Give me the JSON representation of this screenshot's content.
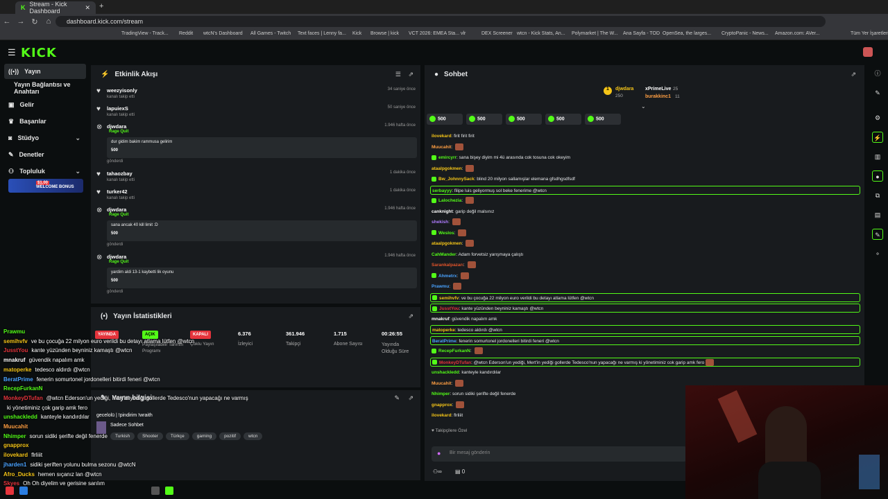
{
  "browser": {
    "tab_title": "Stream - Kick Dashboard",
    "url": "dashboard.kick.com/stream",
    "all_bookmarks": "Tüm Yer İşaretleri",
    "bookmarks": [
      "TradingView - Track...",
      "Reddit",
      "wtcN's Dashboard",
      "All Games - Twitch",
      "Text faces | Lenny fa...",
      "Kick",
      "Browse | kick",
      "VCT 2026: EMEA Sta...",
      "vlr",
      "DEX Screener",
      "wtcn - Kick Stats, An...",
      "Polymarket | The W...",
      "Ana Sayfa - TOD",
      "OpenSea, the larges...",
      "CryptoPanic - News...",
      "Amazon.com: AVer..."
    ]
  },
  "sidebar": {
    "items": [
      {
        "label": "Yayın",
        "icon": "broadcast-icon"
      },
      {
        "label": "Yayın Bağlantısı ve Anahtarı"
      },
      {
        "label": "Gelir",
        "icon": "wallet-icon"
      },
      {
        "label": "Başarılar",
        "icon": "trophy-icon"
      },
      {
        "label": "Stüdyo",
        "icon": "camera-icon"
      },
      {
        "label": "Denetler",
        "icon": "wrench-icon"
      },
      {
        "label": "Topluluk",
        "icon": "users-icon"
      }
    ],
    "promo": {
      "amount": "$1.00",
      "text": "WELCOME BONUS"
    }
  },
  "activity": {
    "title": "Etkinlik Akışı",
    "items": [
      {
        "user": "weezyisonly",
        "sub": "kanalı takip etti",
        "time": "34 saniye önce",
        "type": "follow"
      },
      {
        "user": "lapuiexS",
        "sub": "kanalı takip etti",
        "time": "50 saniye önce",
        "type": "follow"
      },
      {
        "user": "djwdara",
        "action": "Rage Quit",
        "time": "1.946 hafta önce",
        "type": "kicks",
        "message": "dur gidim bakim rammusa gelirim",
        "amount": "500",
        "sent": "gönderdi"
      },
      {
        "user": "tahaozbay",
        "sub": "kanalı takip etti",
        "time": "1 dakika önce",
        "type": "follow"
      },
      {
        "user": "turker42",
        "sub": "kanalı takip etti",
        "time": "1 dakika önce",
        "type": "follow"
      },
      {
        "user": "djwdara",
        "action": "Rage Quit",
        "time": "1.946 hafta önce",
        "type": "kicks",
        "message": "sana ancak 40 kill limit :D",
        "amount": "500",
        "sent": "gönderdi"
      },
      {
        "user": "djwdara",
        "action": "Rage Quit",
        "time": "1.946 hafta önce",
        "type": "kicks",
        "message": "yardim aldi 13-1 kaybetti lik oyunu",
        "amount": "500",
        "sent": "gönderdi"
      }
    ]
  },
  "stats": {
    "title": "Yayın İstatistikleri",
    "badges": [
      {
        "text": "YAYINDA",
        "color": "#e5343c"
      },
      {
        "text": "AÇIK",
        "color": "#53fc18"
      },
      {
        "text": "KAPALI",
        "color": "#e5343c"
      }
    ],
    "badge_labels": [
      "Paylaşılabilir Tahmin Programı",
      "Çoklu Yayın"
    ],
    "values": [
      {
        "v": "6.376",
        "l": "İzleyici"
      },
      {
        "v": "361.946",
        "l": "Takipçi"
      },
      {
        "v": "1.715",
        "l": "Abone Sayısı"
      },
      {
        "v": "00:26:55",
        "l": "Yayında Olduğu Süre"
      }
    ]
  },
  "info": {
    "title": "Yayın bilgisi",
    "stream_title": "gecelolü | !pindirim !wraith",
    "category": "Sadece Sohbet",
    "tags": [
      "Turkish",
      "Shooter",
      "Türkçe",
      "gaming",
      "pozitif",
      "wtcn"
    ]
  },
  "chat": {
    "title": "Sohbet",
    "leaders": [
      {
        "name": "djwdara",
        "value": "250"
      },
      {
        "name": "xPrimeLive",
        "value": "25"
      },
      {
        "name": "burakkinc1",
        "value": "11"
      }
    ],
    "gifts": [
      "500",
      "500",
      "500",
      "500",
      "500"
    ],
    "messages": [
      {
        "user": "ilovekard",
        "text": "firit firit firit",
        "color": "#f5c518"
      },
      {
        "user": "Muucahit",
        "text": "",
        "color": "#ff9f43",
        "emote": true
      },
      {
        "user": "emircyrr",
        "text": "sana bişey diyim mi 4ü arasında cok tosuna cok okeyim",
        "color": "#53fc18",
        "badge": true
      },
      {
        "user": "ataalpgokmen",
        "text": "",
        "color": "#f5c518",
        "emote": true
      },
      {
        "user": "Bw_JohnnySack",
        "text": "blind 20 milyon sallamışlar elemana gfsdhgsdfsdf",
        "color": "#f5c518",
        "badge": true
      },
      {
        "user": "serbayyy",
        "text": "filipe luis geliyormuş sol beke fenerime @wtcn",
        "color": "#53fc18",
        "hl": true
      },
      {
        "user": "Lalochezia",
        "text": "",
        "color": "#53fc18",
        "badge": true,
        "emote": true
      },
      {
        "user": "canknight",
        "text": "garip değil malsınız",
        "color": "#fff"
      },
      {
        "user": "shekish",
        "text": "",
        "color": "#b07cff",
        "emote": true
      },
      {
        "user": "Weslos",
        "text": "",
        "color": "#53fc18",
        "badge": true,
        "emote": true
      },
      {
        "user": "ataalpgokmen",
        "text": "",
        "color": "#f5c518",
        "emote": true
      },
      {
        "user": "CahMander",
        "text": "Adam forvetsiz yarışmaya çalıştı",
        "color": "#53fc18"
      },
      {
        "user": "Sarankalpazarı",
        "text": "",
        "color": "#e2542a",
        "emote": true
      },
      {
        "user": "Ahmetrx",
        "text": "",
        "color": "#4aa3ff",
        "badge": true,
        "emote": true
      },
      {
        "user": "Prawmu",
        "text": "",
        "color": "#4aa3ff",
        "emote": true
      },
      {
        "user": "semihvfv",
        "text": "ve bu çocuğa 22 milyon euro verildi bu detayı atlama lütfen @wtcn",
        "color": "#f5c518",
        "hl": true,
        "badge": true
      },
      {
        "user": "JusstYou",
        "text": "kante yüzünden beyniniz kamaştı @wtcn",
        "color": "#e5343c",
        "hl": true,
        "badge": true
      },
      {
        "user": "mnakruf",
        "text": "güvendik napalım amk",
        "color": "#fff"
      },
      {
        "user": "matoperke",
        "text": "tedesco aldırdı @wtcn",
        "color": "#f5c518",
        "hl": true
      },
      {
        "user": "BeratPrime",
        "text": "fenerin somurtonel jordonelleri bitirdi feneri @wtcn",
        "color": "#4aa3ff",
        "hl": true
      },
      {
        "user": "RecepFurkanN",
        "text": "",
        "color": "#53fc18",
        "badge": true,
        "emote": true
      },
      {
        "user": "MonkeyDTufan",
        "text": "@wtcn Ederson'un yediği, Mert'in yediği gollerde Tedesco'nun yapacağı ne varmış ki yönetiminiz cok garip amk fero",
        "color": "#e5343c",
        "hl": true,
        "badge": true,
        "emote": true
      },
      {
        "user": "unshackledd",
        "text": "kanteyle kandırdılar",
        "color": "#53fc18"
      },
      {
        "user": "Muucahit",
        "text": "",
        "color": "#ff9f43",
        "emote": true
      },
      {
        "user": "Nhimper",
        "text": "sorun sidiki şerifte değil fenerde",
        "color": "#53fc18"
      },
      {
        "user": "gnapprox",
        "text": "",
        "color": "#f5c518",
        "emote": true
      },
      {
        "user": "ilovekard",
        "text": "flrliiit",
        "color": "#f5c518"
      }
    ],
    "followers_only": "Takipçilere Özel",
    "input_placeholder": "Bir mesaj gönderin",
    "footer_count": "0"
  },
  "overlay": {
    "lines": [
      {
        "user": "Prawmu",
        "text": "",
        "color": "#53fc18"
      },
      {
        "user": "semihvfv",
        "text": "ve bu çocuğa 22 milyon euro verildi bu detayı atlama lütfen @wtcn",
        "color": "#f5c518"
      },
      {
        "user": "JusstYou",
        "text": "kante yüzünden beyniniz kamaştı @wtcn",
        "color": "#e5343c"
      },
      {
        "user": "mnakruf",
        "text": "güvendik napalım amk",
        "color": "#fff"
      },
      {
        "user": "matoperke",
        "text": "tedesco aldırdı @wtcn",
        "color": "#f5c518"
      },
      {
        "user": "BeratPrime",
        "text": "fenerin somurtonel jordonelleri bitirdi feneri @wtcn",
        "color": "#4aa3ff"
      },
      {
        "user": "RecepFurkanN",
        "text": "",
        "color": "#53fc18"
      },
      {
        "user": "MonkeyDTufan",
        "text": "@wtcn Ederson'un yediği, Mert'in yediği gollerde Tedesco'nun yapacağı ne varmış",
        "color": "#e5343c"
      },
      {
        "user": "",
        "text": "ki yönetiminiz çok garip amk fero",
        "color": "#fff"
      },
      {
        "user": "unshackledd",
        "text": "kanteyle kandırdılar",
        "color": "#53fc18"
      },
      {
        "user": "Muucahit",
        "text": "",
        "color": "#ff9f43"
      },
      {
        "user": "Nhimper",
        "text": "sorun sidiki şerifte değil fenerde",
        "color": "#53fc18"
      },
      {
        "user": "gnapprox",
        "text": "",
        "color": "#f5c518"
      },
      {
        "user": "ilovekard",
        "text": "flrliiit",
        "color": "#f5c518"
      },
      {
        "user": "jharden1",
        "text": "sidiki şeriften yolunu bulma sezonu @wtcN",
        "color": "#4aa3ff"
      },
      {
        "user": "Afro_Ducks",
        "text": "hemen sıçanız lan @wtcn",
        "color": "#f5c518"
      },
      {
        "user": "Skyes",
        "text": "Oh Oh diyelim ve gerisine sarılım",
        "color": "#e5343c"
      }
    ]
  }
}
